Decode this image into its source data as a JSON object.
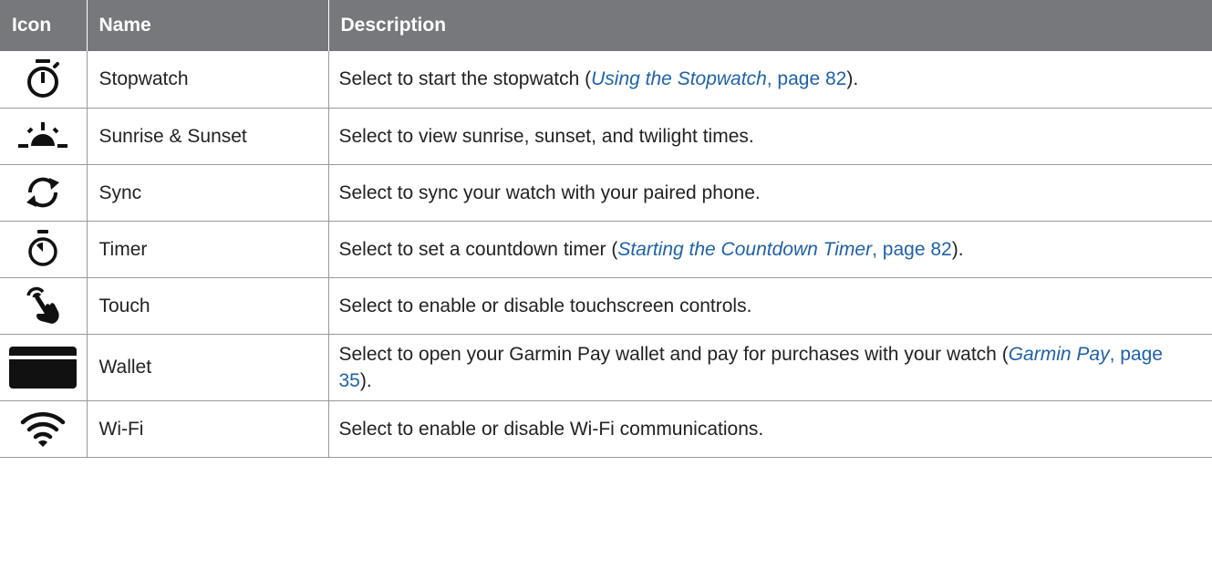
{
  "table": {
    "headers": {
      "icon": "Icon",
      "name": "Name",
      "description": "Description"
    },
    "rows": [
      {
        "icon": "stopwatch-icon",
        "name": "Stopwatch",
        "desc_pre": "Select to start the stopwatch (",
        "desc_link": "Using the Stopwatch",
        "desc_page": "page 82",
        "desc_post": ")."
      },
      {
        "icon": "sunrise-icon",
        "name": "Sunrise & Sunset",
        "desc": "Select to view sunrise, sunset, and twilight times."
      },
      {
        "icon": "sync-icon",
        "name": "Sync",
        "desc": "Select to sync your watch with your paired phone."
      },
      {
        "icon": "timer-icon",
        "name": "Timer",
        "desc_pre": "Select to set a countdown timer (",
        "desc_link": "Starting the Countdown Timer",
        "desc_page": "page 82",
        "desc_post": ")."
      },
      {
        "icon": "touch-icon",
        "name": "Touch",
        "desc": "Select to enable or disable touchscreen controls."
      },
      {
        "icon": "wallet-icon",
        "name": "Wallet",
        "desc_pre": "Select to open your Garmin Pay wallet and pay for purchases with your watch (",
        "desc_link": "Garmin Pay",
        "desc_page": "page 35",
        "desc_post": ")."
      },
      {
        "icon": "wifi-icon",
        "name": "Wi-Fi",
        "desc": "Select to enable or disable Wi-Fi communications."
      }
    ],
    "link_color": "#1f61a8",
    "header_bg": "#76787b"
  }
}
